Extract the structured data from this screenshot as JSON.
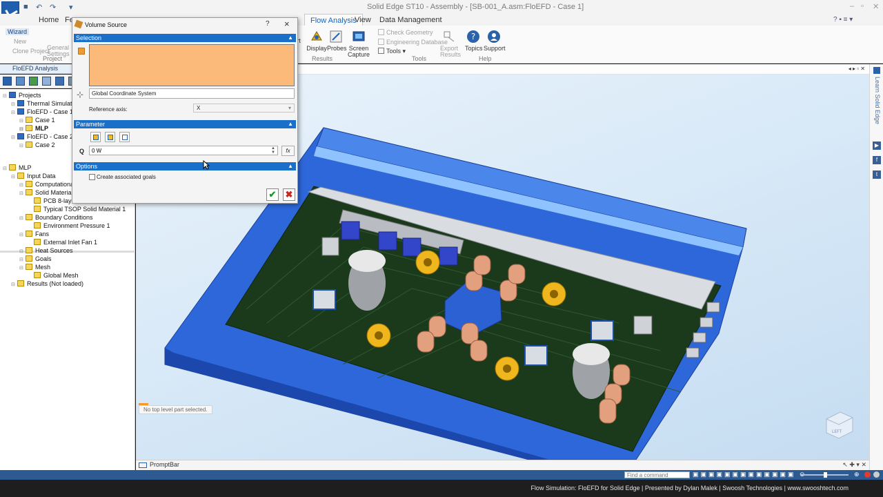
{
  "titlebar": {
    "title": "Solid Edge ST10 - Assembly - [SB-001_A.asm:FloEFD - Case 1]"
  },
  "ribbon": {
    "tabs": [
      "Home",
      "Fe",
      "Flow Analysis",
      "View",
      "Data Management"
    ],
    "active_tab": "Flow Analysis",
    "left": {
      "wizard": "Wizard",
      "new": "New",
      "clone_project": "Clone Project",
      "general_settings": "General Settings",
      "project_group": "Project"
    },
    "results": {
      "insert_partial": "rt",
      "display": "Display",
      "probes": "Probes",
      "screen_capture": "Screen Capture",
      "group": "Results"
    },
    "tools": {
      "check_geometry": "Check Geometry",
      "engineering_database": "Engineering Database",
      "tools": "Tools",
      "export_results": "Export Results",
      "group": "Tools"
    },
    "help": {
      "topics": "Topics",
      "support": "Support",
      "group": "Help"
    }
  },
  "left_panel": {
    "header": "FloEFD Analysis",
    "projects_tree": [
      {
        "label": "Projects",
        "indent": 0,
        "bold": false
      },
      {
        "label": "Thermal Simulation",
        "indent": 1,
        "bold": false
      },
      {
        "label": "FloEFD - Case 1",
        "indent": 1,
        "bold": false
      },
      {
        "label": "Case 1",
        "indent": 2,
        "bold": false
      },
      {
        "label": "MLP",
        "indent": 2,
        "bold": true
      },
      {
        "label": "FloEFD - Case 2",
        "indent": 1,
        "bold": false
      },
      {
        "label": "Case 2",
        "indent": 2,
        "bold": false
      }
    ],
    "analysis_tree": [
      {
        "label": "MLP",
        "indent": 0
      },
      {
        "label": "Input Data",
        "indent": 1
      },
      {
        "label": "Computational",
        "indent": 2
      },
      {
        "label": "Solid Materials",
        "indent": 2
      },
      {
        "label": "PCB 8-laye",
        "indent": 3
      },
      {
        "label": "Typical TSOP Solid Material 1",
        "indent": 3
      },
      {
        "label": "Boundary Conditions",
        "indent": 2
      },
      {
        "label": "Environment Pressure 1",
        "indent": 3
      },
      {
        "label": "Fans",
        "indent": 2
      },
      {
        "label": "External Inlet Fan 1",
        "indent": 3
      },
      {
        "label": "Heat Sources",
        "indent": 2
      },
      {
        "label": "Goals",
        "indent": 2
      },
      {
        "label": "Mesh",
        "indent": 2
      },
      {
        "label": "Global Mesh",
        "indent": 3
      },
      {
        "label": "Results (Not loaded)",
        "indent": 1
      }
    ]
  },
  "dialog": {
    "title": "Volume Source",
    "help": "?",
    "close": "×",
    "selection_header": "Selection",
    "coordinate_system": "Global Coordinate System",
    "reference_axis_label": "Reference axis:",
    "reference_axis_value": "X",
    "parameter_header": "Parameter",
    "q_label": "Q",
    "q_value": "0 W",
    "fx_label": "fx",
    "options_header": "Options",
    "create_goals_label": "Create associated goals",
    "create_goals_checked": false,
    "ok": "✔",
    "cancel": "✖",
    "selection_color": "#fcba7a"
  },
  "viewport": {
    "status_message": "No top level part selected.",
    "view_cube_face": "LEFT"
  },
  "right_bar": {
    "learn_text": "Learn Solid Edge"
  },
  "promptbar": {
    "label": "PromptBar"
  },
  "statusbar": {
    "find_placeholder": "Find a command"
  },
  "credit": {
    "text": "Flow Simulation: FloEFD for Solid Edge | Presented by Dylan Malek | Swoosh Technologies | www.swooshtech.com"
  },
  "colors": {
    "accent": "#1a6fc9",
    "enclosure_blue": "#2b63d8",
    "pcb_green": "#1b3a1b"
  }
}
